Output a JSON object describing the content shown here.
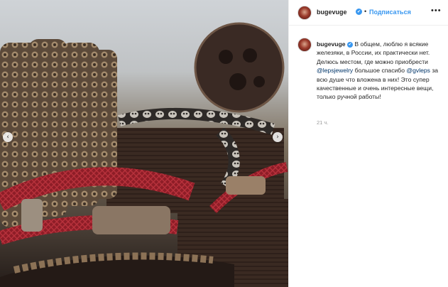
{
  "post": {
    "username": "bugevuge",
    "verified_glyph": "✔",
    "separator": "•",
    "follow_label": "Подписаться",
    "more_glyph": "•••",
    "caption": {
      "text_1": " В общем, люблю я всякие железяки, в России, их практически нет. Делюсь местом, где можно приобрести ",
      "mention_1": "@lepsjewelry",
      "text_2": " большое спасибо ",
      "mention_2": "@gvleps",
      "text_3": " за всю душе что вложена в них! Это супер качественные и очень интересные вещи, только ручной работы!"
    },
    "timestamp": "21 ч."
  },
  "carousel": {
    "prev_glyph": "‹",
    "next_glyph": "›"
  },
  "icons": {
    "avatar": "avatar",
    "verified": "verified-badge-icon",
    "more": "more-options-icon"
  },
  "colors": {
    "accent": "#3897f0",
    "text": "#262626",
    "muted": "#999999",
    "mention": "#003569"
  }
}
